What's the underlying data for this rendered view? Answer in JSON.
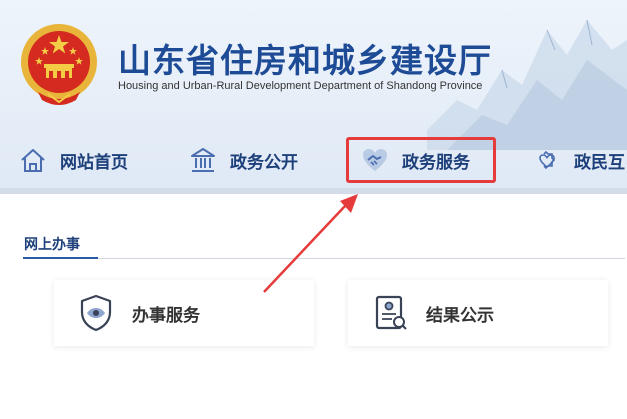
{
  "header": {
    "title": "山东省住房和城乡建设厅",
    "subtitle": "Housing and Urban-Rural Development Department of Shandong Province"
  },
  "nav": {
    "items": [
      {
        "label": "网站首页",
        "icon": "home-icon"
      },
      {
        "label": "政务公开",
        "icon": "government-building-icon"
      },
      {
        "label": "政务服务",
        "icon": "handshake-heart-icon"
      },
      {
        "label": "政民互",
        "icon": "people-heart-icon"
      }
    ]
  },
  "section": {
    "title": "网上办事"
  },
  "cards": [
    {
      "label": "办事服务",
      "icon": "shield-eye-icon"
    },
    {
      "label": "结果公示",
      "icon": "document-search-icon"
    }
  ],
  "colors": {
    "brand_blue": "#1d4b95",
    "nav_text": "#1d3f7a",
    "highlight_red": "#e53b3b",
    "header_bg": "#e8f0f9"
  }
}
